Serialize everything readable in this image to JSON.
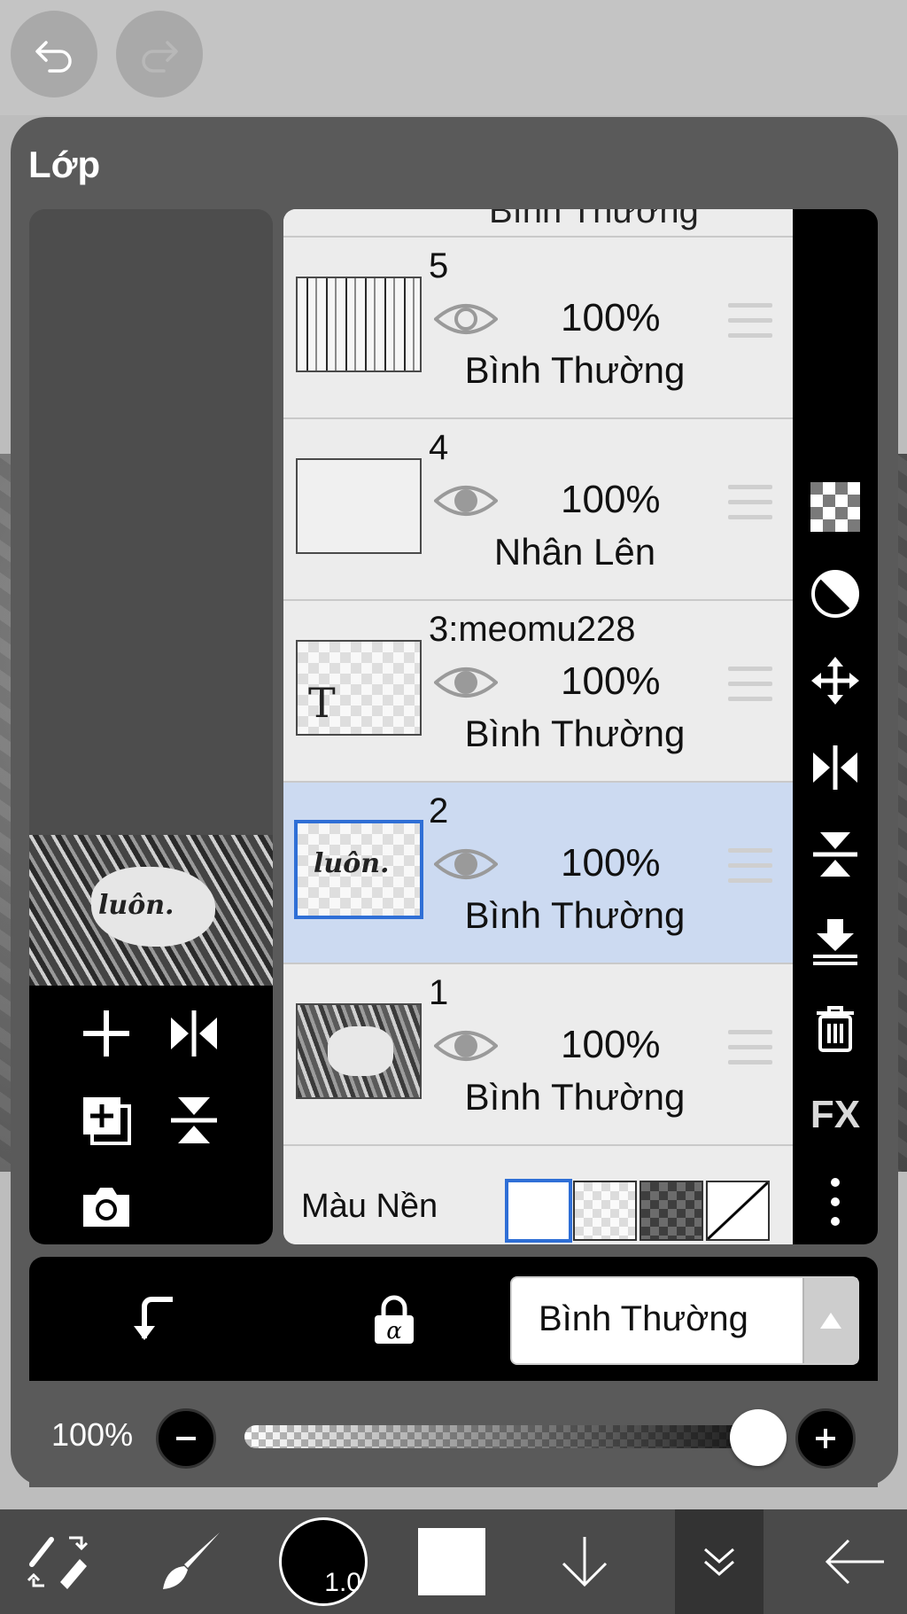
{
  "panel": {
    "title": "Lớp"
  },
  "layers_peek_blend": "Bình Thường",
  "layers": [
    {
      "name": "5",
      "opacity": "100%",
      "blend": "Bình Thường",
      "visible": true,
      "selected": false
    },
    {
      "name": "4",
      "opacity": "100%",
      "blend": "Nhân Lên",
      "visible": true,
      "selected": false
    },
    {
      "name": "3:meomu228",
      "opacity": "100%",
      "blend": "Bình Thường",
      "visible": true,
      "selected": false
    },
    {
      "name": "2",
      "opacity": "100%",
      "blend": "Bình Thường",
      "visible": true,
      "selected": true
    },
    {
      "name": "1",
      "opacity": "100%",
      "blend": "Bình Thường",
      "visible": true,
      "selected": false
    }
  ],
  "background": {
    "label": "Màu Nền",
    "options": [
      "white",
      "transparent",
      "dark-checker",
      "diagonal"
    ],
    "selected": "white"
  },
  "thumb_text": "T",
  "right_tools": [
    "checker-icon",
    "contrast-icon",
    "move-icon",
    "flip-horizontal-icon",
    "flip-vertical-icon",
    "merge-down-icon",
    "trash-icon",
    "fx-icon",
    "more-icon"
  ],
  "fx_label": "FX",
  "blend_mode": {
    "current": "Bình Thường"
  },
  "opacity": {
    "label": "100%",
    "value": 1.0
  },
  "brush": {
    "size": "1.0"
  },
  "colors": {
    "accent": "#2f6fd6",
    "selected_row": "#ccdaf1"
  }
}
